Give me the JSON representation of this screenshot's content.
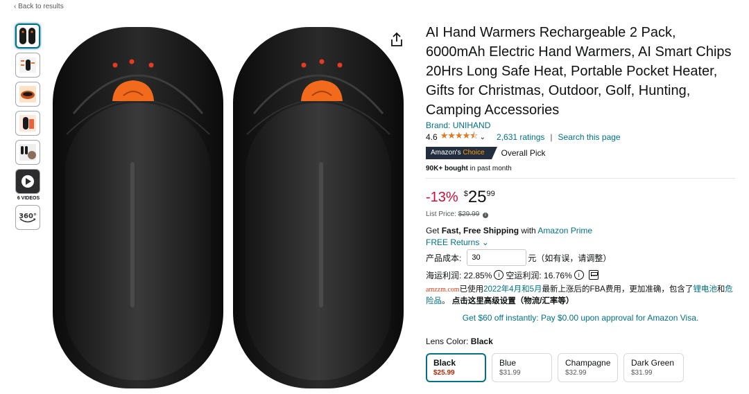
{
  "nav": {
    "back_label": "Back to results"
  },
  "gallery": {
    "videos_label": "6 VIDEOS",
    "view360_label": "360°"
  },
  "product": {
    "title": "AI Hand Warmers Rechargeable 2 Pack, 6000mAh Electric Hand Warmers, AI Smart Chips 20Hrs Long Safe Heat, Portable Pocket Heater, Gifts for Christmas, Outdoor, Golf, Hunting, Camping Accessories",
    "brand": "Brand: UNIHAND",
    "rating": "4.6",
    "stars": "★★★★⯪",
    "ratings_count": "2,631 ratings",
    "search_page": "Search this page",
    "separator": "|",
    "badge_prefix": "Amazon's",
    "badge_suffix": "Choice",
    "badge_label": "Overall Pick",
    "bought_bold": "90K+ bought",
    "bought_rest": "in past month"
  },
  "price": {
    "discount": "-13%",
    "symbol": "$",
    "whole": "25",
    "fraction": "99",
    "list_label": "List Price:",
    "list_value": "$29.99"
  },
  "shipping": {
    "prefix": "Get",
    "bold": "Fast, Free Shipping",
    "with": "with",
    "prime": "Amazon Prime",
    "returns": "FREE Returns"
  },
  "plugin": {
    "cost_label": "产品成本:",
    "cost_value": "30",
    "cost_suffix": "元（如有误，请调整）",
    "sea_profit": "海运利润: 22.85%",
    "air_profit": "空运利润: 16.76%",
    "note_brand": "amzzm.com",
    "note_a": "已使用",
    "note_link1": "2022年4月和5月",
    "note_b": "最新上涨后的FBA费用，更加准确，包含了",
    "note_link2": "锂电池",
    "note_c": "和",
    "note_link3": "危险品",
    "note_d": "。",
    "note_bold": "点击这里高级设置（物流/汇率等）"
  },
  "promo": {
    "text": "Get $60 off instantly: Pay $0.00 upon approval for Amazon Visa."
  },
  "variants": {
    "label": "Lens Color:",
    "selected": "Black",
    "options": [
      {
        "name": "Black",
        "price": "$25.99"
      },
      {
        "name": "Blue",
        "price": "$31.99"
      },
      {
        "name": "Champagne",
        "price": "$32.99"
      },
      {
        "name": "Dark Green",
        "price": "$31.99"
      }
    ]
  },
  "colors": {
    "link": "#007185",
    "discount": "#cc0c39",
    "star": "#de7921",
    "badge_bg": "#232f3e",
    "badge_orange": "#ff9900",
    "device_orange": "#f26b1d"
  }
}
